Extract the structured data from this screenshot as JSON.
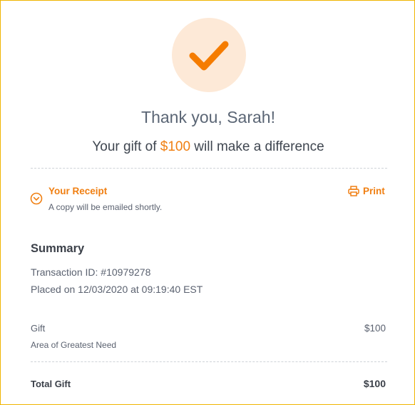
{
  "header": {
    "icon": "checkmark-icon",
    "thanks_text": "Thank you, Sarah!",
    "gift_prefix": "Your gift of ",
    "gift_amount": "$100",
    "gift_suffix": " will make a difference"
  },
  "receipt": {
    "toggle_icon": "chevron-down-circle-icon",
    "title": "Your Receipt",
    "subtitle": "A copy will be emailed shortly.",
    "print_icon": "printer-icon",
    "print_label": "Print"
  },
  "summary": {
    "title": "Summary",
    "transaction": "Transaction ID: #10979278",
    "placed": "Placed on 12/03/2020 at 09:19:40 EST",
    "gift_label": "Gift",
    "gift_fund": "Area of Greatest Need",
    "gift_value": "$100",
    "total_label": "Total Gift",
    "total_value": "$100"
  },
  "colors": {
    "accent": "#f07f12",
    "check_bg": "#fde9d7",
    "frame_border": "#f0b400"
  }
}
